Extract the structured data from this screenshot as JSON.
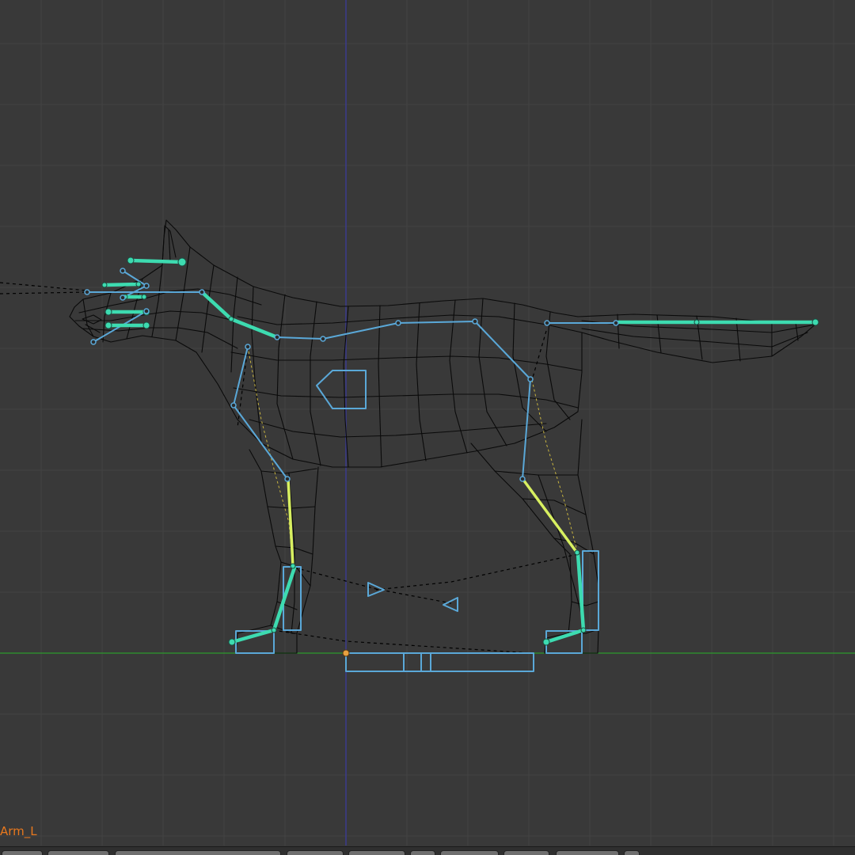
{
  "viewport": {
    "active_object_label": "Arm_L",
    "grid": true,
    "colors": {
      "background": "#393939",
      "grid_line": "#434343",
      "x_axis": "#2f8a2f",
      "z_axis": "#3a3a8e",
      "mesh_wire": "#0a0a0a",
      "bone_unselected": "#5aa8d8",
      "bone_selected": "#3ddbb0",
      "bone_active": "#d8f060",
      "ik_line": "#000000",
      "pole_line": "#c8b440",
      "origin_point": "#e8a040",
      "label_text": "#e8781e"
    }
  },
  "header_bar": {
    "icons": [
      "view-menu-icon",
      "select-menu-icon",
      "pose-menu-icon",
      "mode-selector-icon",
      "shading-icon",
      "pivot-icon",
      "manipulator-icon",
      "layers-icon",
      "pose-copy-icon",
      "pose-paste-icon"
    ]
  }
}
